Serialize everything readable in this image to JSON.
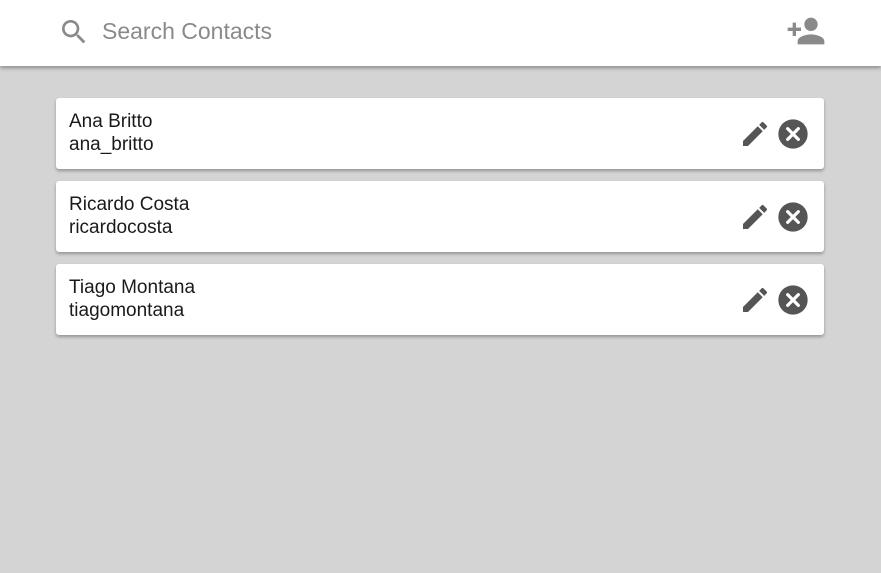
{
  "search": {
    "placeholder": "Search Contacts",
    "value": ""
  },
  "icons": {
    "search": "search-icon",
    "add_user": "add-user-icon",
    "edit": "pencil-icon",
    "delete": "close-circle-icon"
  },
  "colors": {
    "background": "#d4d4d4",
    "header": "#ffffff",
    "card": "#ffffff",
    "icon_gray": "#8a8a8a",
    "icon_dark": "#555555",
    "text": "#1a1a1a"
  },
  "contacts": [
    {
      "name": "Ana Britto",
      "username": "ana_britto"
    },
    {
      "name": "Ricardo Costa",
      "username": "ricardocosta"
    },
    {
      "name": "Tiago Montana",
      "username": "tiagomontana"
    }
  ]
}
